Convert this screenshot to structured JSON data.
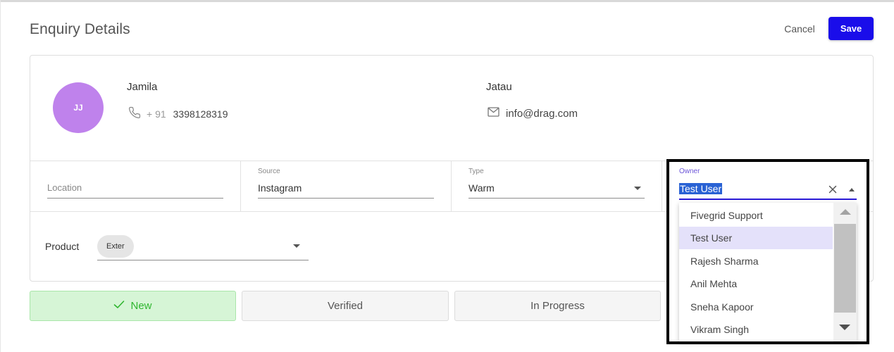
{
  "header": {
    "title": "Enquiry Details",
    "cancel_label": "Cancel",
    "save_label": "Save"
  },
  "contact": {
    "avatar_initials": "JJ",
    "first_name": "Jamila",
    "last_name": "Jatau",
    "phone_code": "+ 91",
    "phone_number": "3398128319",
    "email": "info@drag.com"
  },
  "fields": {
    "location": {
      "label": "",
      "placeholder": "Location",
      "value": ""
    },
    "source": {
      "label": "Source",
      "value": "Instagram"
    },
    "type": {
      "label": "Type",
      "value": "Warm"
    }
  },
  "product": {
    "label": "Product",
    "chip": "Exter"
  },
  "owner": {
    "label": "Owner",
    "value": "Test User",
    "options": [
      "Fivegrid Support",
      "Test User",
      "Rajesh Sharma",
      "Anil Mehta",
      "Sneha Kapoor",
      "Vikram Singh"
    ],
    "selected_index": 1
  },
  "status": {
    "steps": [
      "New",
      "Verified",
      "In Progress"
    ],
    "active_index": 0
  },
  "colors": {
    "primary": "#1a0dea",
    "avatar": "#bf82ec",
    "active_status_bg": "#d6f5d6",
    "active_status_text": "#2fb62f",
    "selected_option_bg": "#e4e1fa",
    "text_highlight": "#2962d4"
  },
  "icons": {
    "phone": "phone-icon",
    "email": "mail-icon",
    "check": "check-icon",
    "clear": "close-icon"
  }
}
